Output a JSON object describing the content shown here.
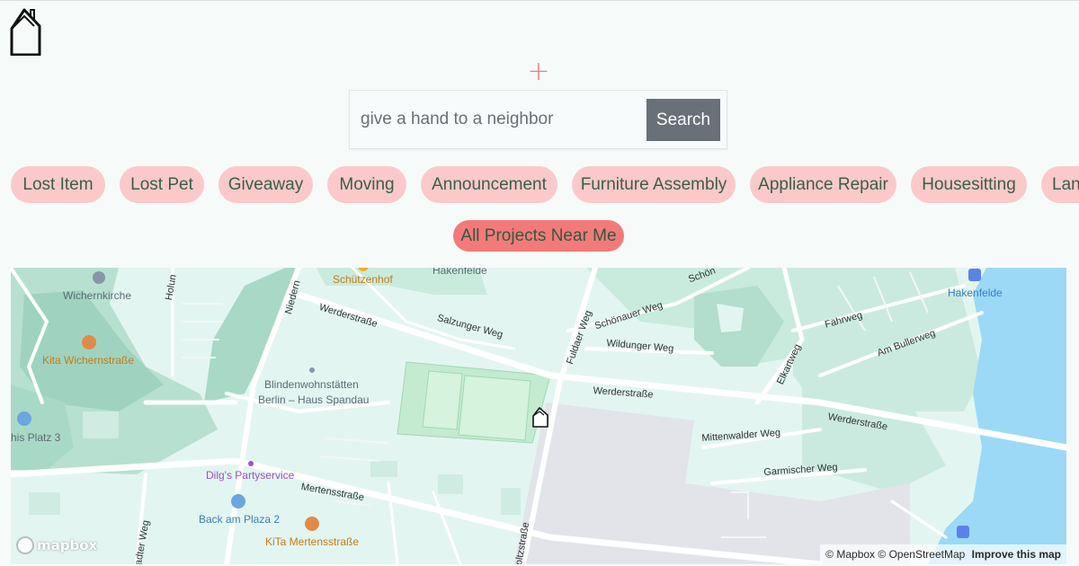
{
  "header": {
    "logo_icon": "house-outline-icon",
    "add_icon": "plus-icon",
    "accent_color": "#f47a7a"
  },
  "search": {
    "placeholder": "give a hand to a neighbor",
    "button_label": "Search"
  },
  "categories": [
    "Lost Item",
    "Lost Pet",
    "Giveaway",
    "Moving",
    "Announcement",
    "Furniture Assembly",
    "Appliance Repair",
    "Housesitting",
    "Lan"
  ],
  "all_projects_label": "All Projects Near Me",
  "map": {
    "labels": {
      "wichernkirche": "Wichernkirche",
      "holun": "Holun",
      "niedern": "Niedern",
      "schuetzenhof": "Schützenhof",
      "hakenfelde_top": "Hakenfelde",
      "werderstrasse_1": "Werderstraße",
      "salzunger": "Salzunger Weg",
      "fuldaer": "Fuldaer Weg",
      "schoenauer": "Schönauer Weg",
      "schoen": "Schön",
      "wildunger": "Wildunger Weg",
      "hakenfelde_water": "Hakenfelde",
      "faehrweg": "Fährweg",
      "am_bullerweg": "Am Bullerweg",
      "elkartweg": "Elkartweg",
      "kita_wichern": "Kita Wichernstraße",
      "blinden_1": "Blindenwohnstätten",
      "blinden_2": "Berlin – Haus Spandau",
      "werderstrasse_2": "Werderstraße",
      "werderstrasse_3": "Werderstraße",
      "mittenwalder": "Mittenwalder Weg",
      "garmischer": "Garmischer Weg",
      "platz3": "his Platz 3",
      "dilgs": "Dilg's Partyservice",
      "mertensstrasse": "Mertensstraße",
      "back_am_plaza": "Back am Plaza 2",
      "kita_mertens": "KiTa Mertensstraße",
      "adter_weg": "adter Weg",
      "oltzstrasse": "oltzstraße"
    },
    "mapbox_logo_text": "mapbox",
    "attribution": {
      "mapbox": "© Mapbox",
      "osm": "© OpenStreetMap",
      "improve": "Improve this map"
    },
    "colors": {
      "background": "#e3f5f1",
      "park": "#b7e0d0",
      "water": "#9bd9f7",
      "industrial": "#e2e4ea",
      "road": "#ffffff"
    }
  }
}
